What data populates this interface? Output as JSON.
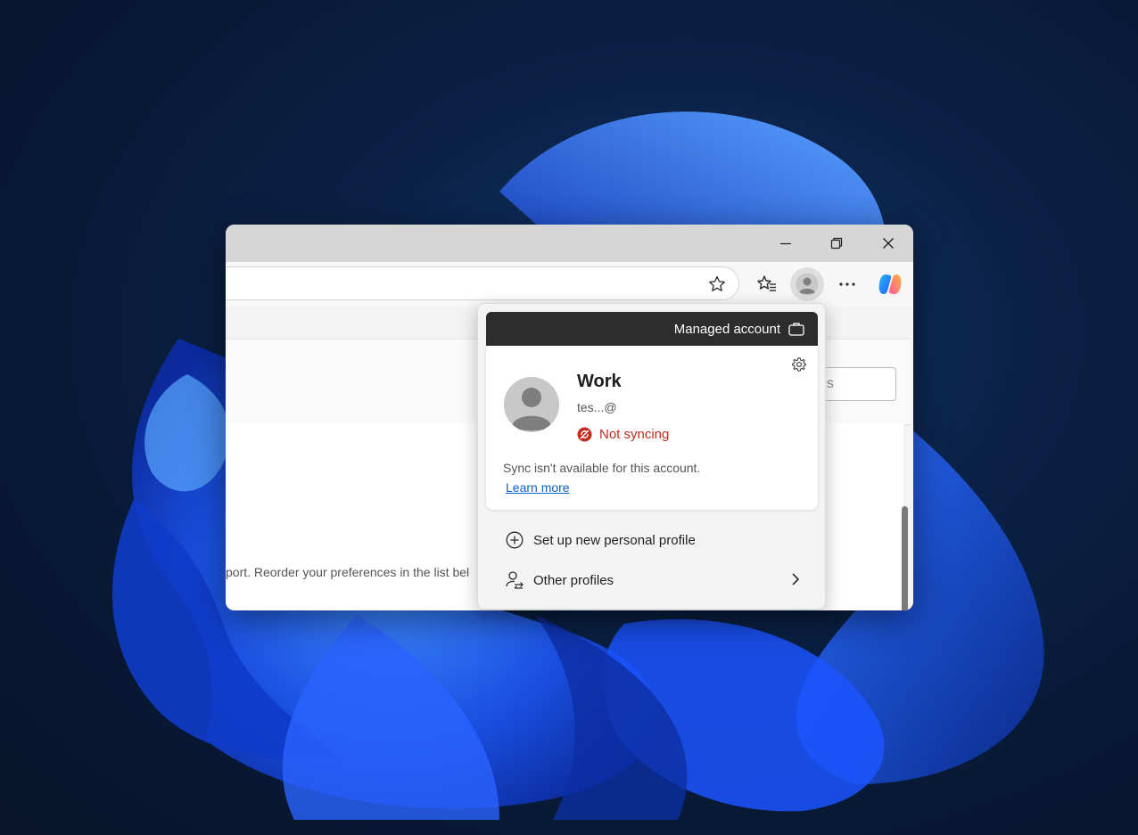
{
  "window": {
    "controls": {
      "minimize": "minimize-icon",
      "restore": "restore-icon",
      "close": "close-icon"
    }
  },
  "toolbar": {
    "icons": [
      "star-icon",
      "favorites-icon",
      "profile-avatar-icon",
      "more-icon",
      "copilot-icon"
    ]
  },
  "page": {
    "search_placeholder": "gs",
    "reorder_text": "port. Reorder your preferences in the list bel"
  },
  "flyout": {
    "managed_label": "Managed account",
    "profile_name": "Work",
    "profile_email": "tes...@",
    "sync_status": "Not syncing",
    "sync_message": "Sync isn't available for this account.",
    "learn_more": "Learn more",
    "menu": {
      "new_profile": "Set up new personal profile",
      "other_profiles": "Other profiles"
    }
  },
  "colors": {
    "accent_link": "#0f5ec7",
    "error": "#c42b1c",
    "managed_bar": "#2d2d2d"
  }
}
